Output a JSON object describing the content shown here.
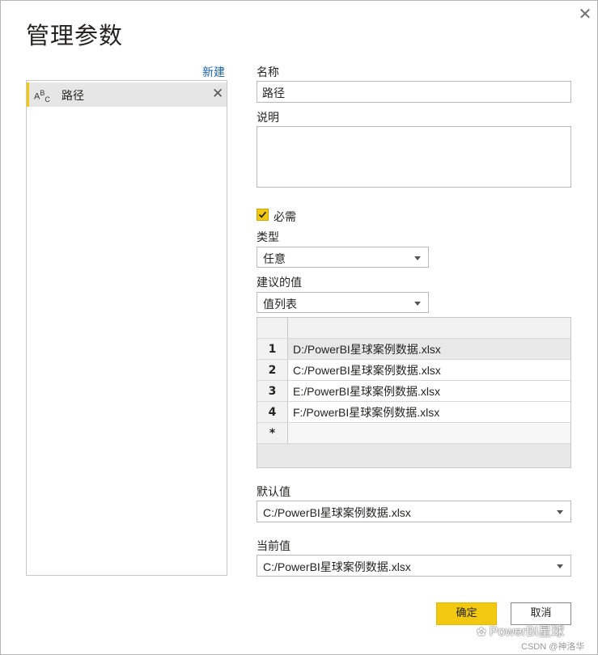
{
  "dialog": {
    "title": "管理参数",
    "close_icon": "close-icon"
  },
  "params_panel": {
    "new_label": "新建",
    "items": [
      {
        "type_icon": "abc-text-icon",
        "name": "路径",
        "remove_icon": "close-icon"
      }
    ]
  },
  "form": {
    "name_label": "名称",
    "name_value": "路径",
    "description_label": "说明",
    "description_value": "",
    "required_label": "必需",
    "required_checked": true,
    "type_label": "类型",
    "type_value": "任意",
    "suggested_label": "建议的值",
    "suggested_value": "值列表",
    "values_table": {
      "rows": [
        {
          "num": "1",
          "value": "D:/PowerBI星球案例数据.xlsx"
        },
        {
          "num": "2",
          "value": "C:/PowerBI星球案例数据.xlsx"
        },
        {
          "num": "3",
          "value": "E:/PowerBI星球案例数据.xlsx"
        },
        {
          "num": "4",
          "value": "F:/PowerBI星球案例数据.xlsx"
        }
      ],
      "new_row_marker": "*"
    },
    "default_label": "默认值",
    "default_value": "C:/PowerBI星球案例数据.xlsx",
    "current_label": "当前值",
    "current_value": "C:/PowerBI星球案例数据.xlsx"
  },
  "buttons": {
    "ok": "确定",
    "cancel": "取消"
  },
  "watermark": {
    "text": "PowerBI星球",
    "csdn": "CSDN @神洛华"
  },
  "colors": {
    "accent": "#f2c811",
    "link": "#1e64a8"
  }
}
